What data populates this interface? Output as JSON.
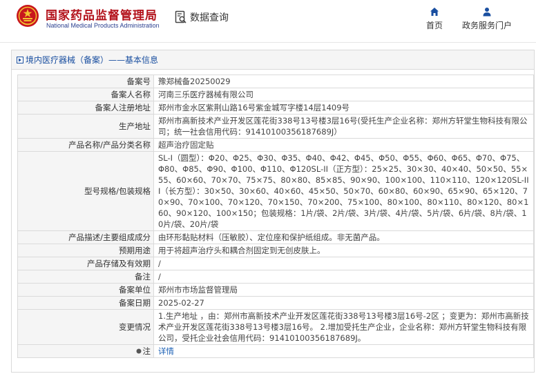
{
  "header": {
    "site_name_cn": "国家药品监督管理局",
    "site_name_en": "National Medical Products Administration",
    "query_title": "数据查询",
    "nav": {
      "home_label": "首页",
      "portal_label": "政务服务门户"
    }
  },
  "panel": {
    "title": "境内医疗器械（备案）——基本信息"
  },
  "record": {
    "rows": [
      {
        "key": "备案号",
        "value": "豫郑械备20250029"
      },
      {
        "key": "备案人名称",
        "value": "河南三乐医疗器械有限公司"
      },
      {
        "key": "备案人注册地址",
        "value": "郑州市金水区紫荆山路16号紫金城写字楼14层1409号"
      },
      {
        "key": "生产地址",
        "value": "郑州市高新技术产业开发区莲花街338号13号楼3层16号(受托生产企业名称：郑州方轩堂生物科技有限公司；统一社会信用代码：91410100356187689J）"
      },
      {
        "key": "产品名称/产品分类名称",
        "value": "超声治疗固定贴"
      },
      {
        "key": "型号规格/包装规格",
        "value": "SL-I（圆型）：Φ20、Φ25、Φ30、Φ35、Φ40、Φ42、Φ45、Φ50、Φ55、Φ60、Φ65、Φ70、Φ75、Φ80、Φ85、Φ90、Φ100、Φ110、Φ120SL-II（正方型）：25×25、30×30、40×40、50×50、55×55、60×60、70×70、75×75、80×80、85×85、90×90、100×100、110×110、120×120SL-III（长方型）：30×50、30×60、40×60、45×50、50×70、60×80、60×90、65×90、65×120、70×90、70×100、70×120、70×150、70×200、75×100、80×100、80×110、80×120、80×160、90×120、100×150；包装规格：1片/袋、2片/袋、3片/袋、4片/袋、5片/袋、6片/袋、8片/袋、10片/袋、20片/袋"
      },
      {
        "key": "产品描述/主要组成成分",
        "value": "由环形黏贴材料（压敏胶）、定位座和保护纸组成。非无菌产品。"
      },
      {
        "key": "预期用途",
        "value": "用于将超声治疗头和耦合剂固定到无创皮肤上。"
      },
      {
        "key": "产品存储及有效期",
        "value": "/"
      },
      {
        "key": "备注",
        "value": "/"
      },
      {
        "key": "备案单位",
        "value": "郑州市市场监督管理局"
      },
      {
        "key": "备案日期",
        "value": "2025-02-27"
      },
      {
        "key": "变更情况",
        "value": "1.生产地址 ，由：郑州市高新技术产业开发区莲花街338号13号楼3层16号-2区 ；变更为：郑州市高新技术产业开发区莲花街338号13号楼3层16号。 2.增加受托生产企业，企业名称：郑州方轩堂生物科技有限公司，受托企业社会信用代码：91410100356187689J。"
      }
    ],
    "note_label": "注",
    "detail_link": "详情"
  },
  "colors": {
    "brand_red": "#b3121b",
    "link_blue": "#1a5fb4",
    "nav_blue": "#1a4fa0"
  }
}
